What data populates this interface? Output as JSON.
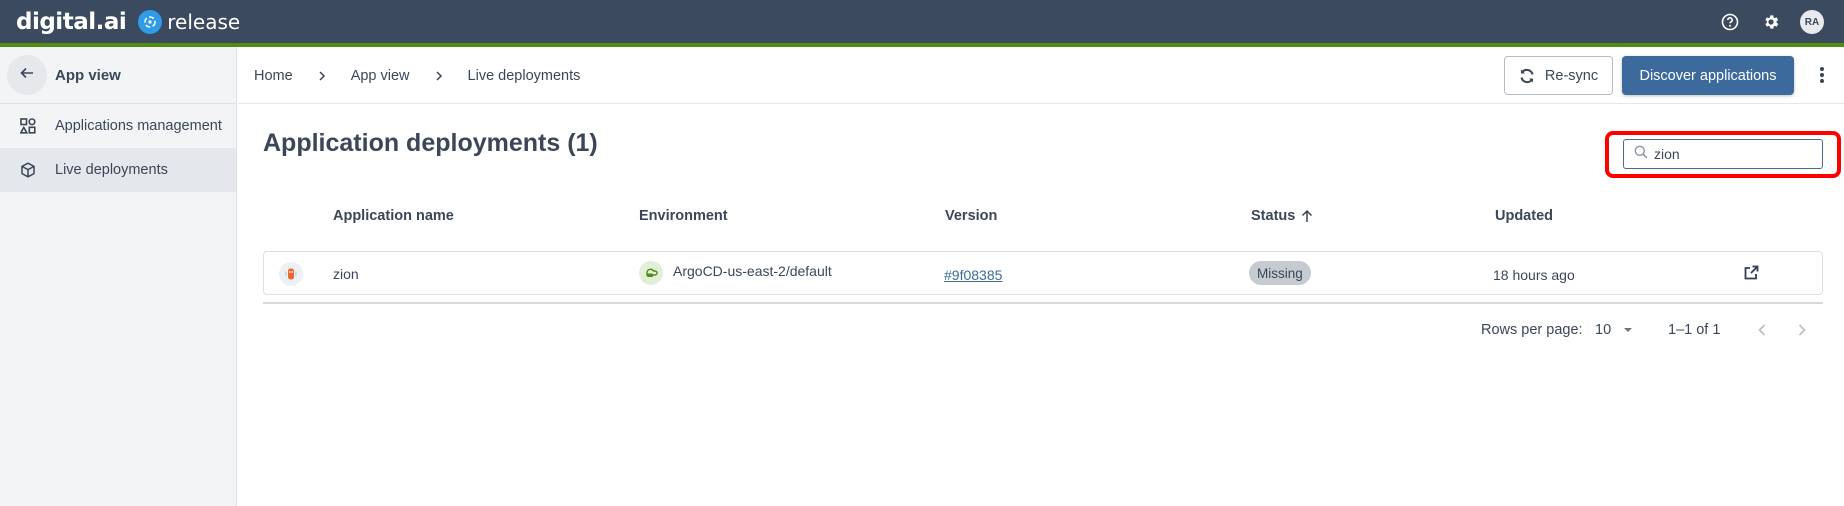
{
  "topbar": {
    "brand": "digital.ai",
    "product": "release",
    "help_icon": "help-circle-icon",
    "settings_icon": "gear-icon",
    "avatar_initials": "RA",
    "accent_color": "#4f8c0f",
    "bg_color": "#3b4a5e"
  },
  "sidebar": {
    "back_icon": "arrow-left-icon",
    "title": "App view",
    "items": [
      {
        "label": "Applications management",
        "icon": "apps-grid-icon",
        "active": false
      },
      {
        "label": "Live deployments",
        "icon": "package-icon",
        "active": true
      }
    ]
  },
  "breadcrumb": [
    {
      "label": "Home"
    },
    {
      "label": "App view"
    },
    {
      "label": "Live deployments"
    }
  ],
  "toolbar": {
    "resync_label": "Re-sync",
    "discover_label": "Discover applications",
    "more_icon": "more-vertical-icon",
    "primary_color": "#3d6a9c"
  },
  "main": {
    "title": "Application deployments (1)",
    "search": {
      "value": "zion",
      "placeholder": "",
      "highlight_color": "#ff0000"
    },
    "table": {
      "columns": [
        {
          "label": "Application name"
        },
        {
          "label": "Environment"
        },
        {
          "label": "Version"
        },
        {
          "label": "Status",
          "sort": "ascending"
        },
        {
          "label": "Updated"
        }
      ],
      "rows": [
        {
          "app_icon": "argo-app-icon",
          "application_name": "zion",
          "environment_icon": "argocd-cloud-icon",
          "environment": "ArgoCD-us-east-2/default",
          "version": "#9f08385",
          "status": "Missing",
          "updated": "18 hours ago",
          "action_icon": "external-link-icon"
        }
      ]
    },
    "pagination": {
      "rows_per_page_label": "Rows per page:",
      "rows_per_page_value": "10",
      "range": "1–1 of 1",
      "prev_icon": "chevron-left-icon",
      "next_icon": "chevron-right-icon"
    }
  }
}
